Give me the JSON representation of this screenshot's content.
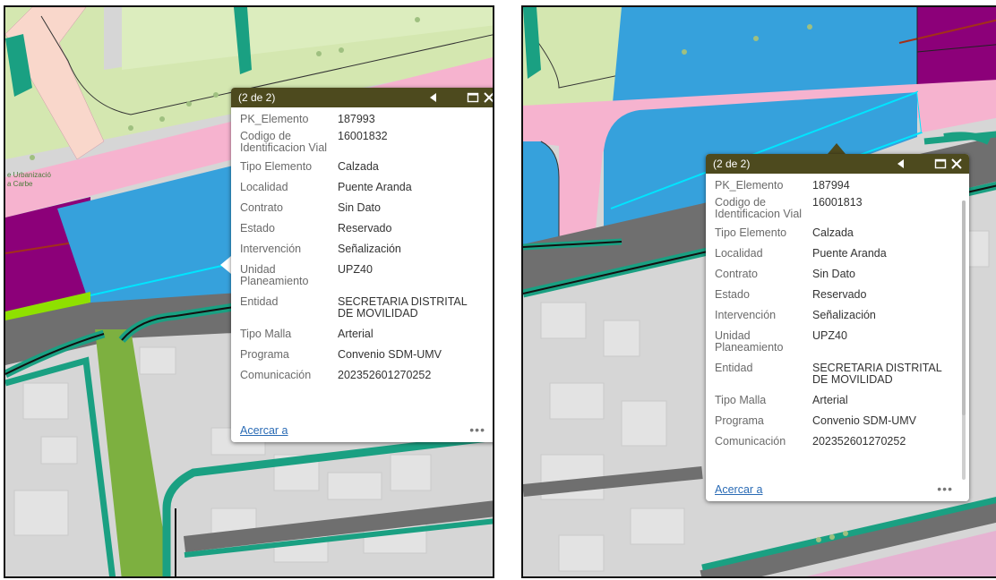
{
  "map_labels": {
    "urbanization_line1": "e Urbanizació",
    "urbanization_line2": "a Carbe"
  },
  "popups": [
    {
      "title": "(2 de 2)",
      "fields": [
        {
          "label": "PK_Elemento",
          "value": "187993"
        },
        {
          "label": "Codigo de Identificacion Vial",
          "value": "16001832"
        },
        {
          "label": "Tipo Elemento",
          "value": "Calzada"
        },
        {
          "label": "Localidad",
          "value": "Puente Aranda"
        },
        {
          "label": "Contrato",
          "value": "Sin Dato"
        },
        {
          "label": "Estado",
          "value": "Reservado"
        },
        {
          "label": "Intervención",
          "value": "Señalización"
        },
        {
          "label": "Unidad Planeamiento",
          "value": "UPZ40"
        },
        {
          "label": "Entidad",
          "value": "SECRETARIA DISTRITAL DE MOVILIDAD"
        },
        {
          "label": "Tipo Malla",
          "value": "Arterial"
        },
        {
          "label": "Programa",
          "value": "Convenio SDM-UMV"
        },
        {
          "label": "Comunicación",
          "value": "202352601270252"
        }
      ],
      "zoom_label": "Acercar a",
      "more_label": "•••"
    },
    {
      "title": "(2 de 2)",
      "fields": [
        {
          "label": "PK_Elemento",
          "value": "187994"
        },
        {
          "label": "Codigo de Identificacion Vial",
          "value": "16001813"
        },
        {
          "label": "Tipo Elemento",
          "value": "Calzada"
        },
        {
          "label": "Localidad",
          "value": "Puente Aranda"
        },
        {
          "label": "Contrato",
          "value": "Sin Dato"
        },
        {
          "label": "Estado",
          "value": "Reservado"
        },
        {
          "label": "Intervención",
          "value": "Señalización"
        },
        {
          "label": "Unidad Planeamiento",
          "value": "UPZ40"
        },
        {
          "label": "Entidad",
          "value": "SECRETARIA DISTRITAL DE MOVILIDAD"
        },
        {
          "label": "Tipo Malla",
          "value": "Arterial"
        },
        {
          "label": "Programa",
          "value": "Convenio SDM-UMV"
        },
        {
          "label": "Comunicación",
          "value": "202352601270252"
        }
      ],
      "zoom_label": "Acercar a",
      "more_label": "•••"
    }
  ],
  "colors": {
    "header": "#4d4a1e",
    "road_blue": "#36a1dc",
    "pink": "#f6b3cf",
    "light_green": "#d4e7b0",
    "teal": "#1aa082",
    "purple": "#8c0079",
    "link": "#2a6bb5"
  },
  "icons": [
    "previous-arrow-icon",
    "maximize-icon",
    "close-icon",
    "more-options-icon"
  ]
}
